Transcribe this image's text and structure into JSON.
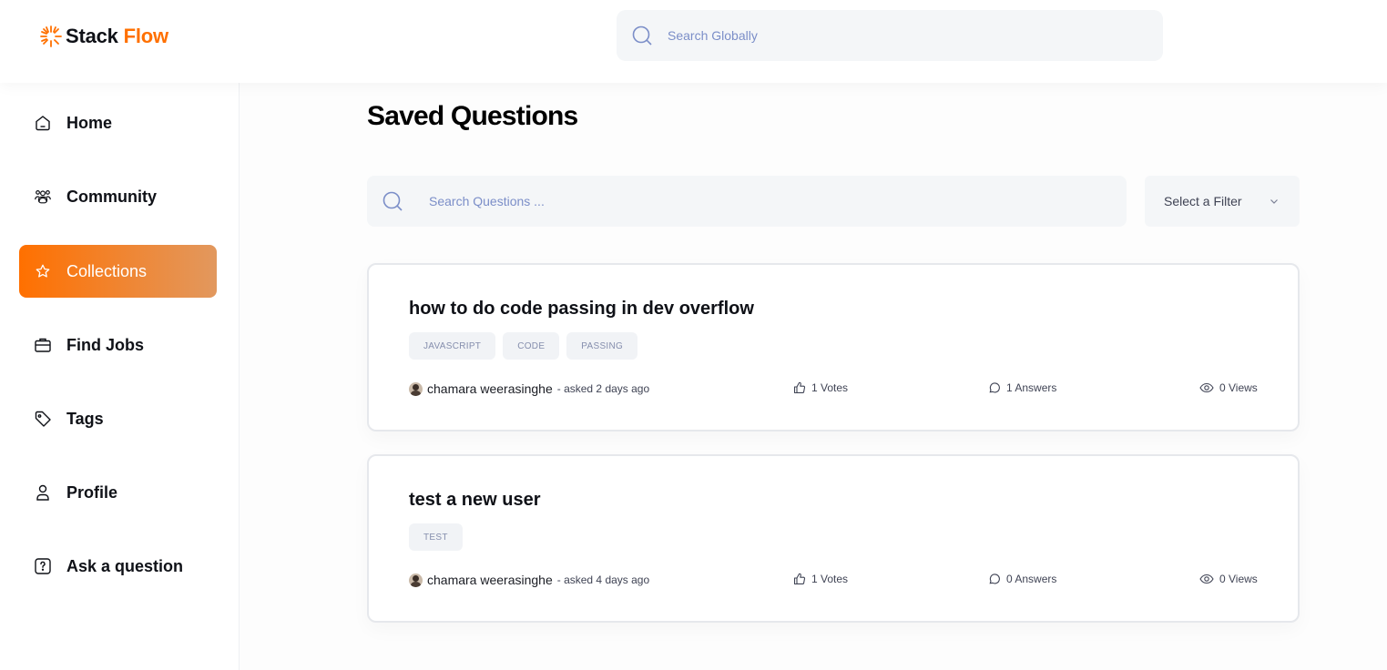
{
  "brand": {
    "name_part1": "Stack",
    "name_part2": "Flow",
    "accent": "#ff7000"
  },
  "global_search": {
    "placeholder": "Search Globally"
  },
  "sidebar": {
    "items": [
      {
        "label": "Home",
        "icon": "home-icon",
        "active": false
      },
      {
        "label": "Community",
        "icon": "users-icon",
        "active": false
      },
      {
        "label": "Collections",
        "icon": "star-icon",
        "active": true
      },
      {
        "label": "Find Jobs",
        "icon": "briefcase-icon",
        "active": false
      },
      {
        "label": "Tags",
        "icon": "tag-icon",
        "active": false
      },
      {
        "label": "Profile",
        "icon": "user-icon",
        "active": false
      },
      {
        "label": "Ask a question",
        "icon": "question-icon",
        "active": false
      }
    ]
  },
  "main": {
    "title": "Saved Questions",
    "search": {
      "placeholder": "Search Questions ..."
    },
    "filter": {
      "label": "Select a Filter"
    },
    "questions": [
      {
        "title": "how to do code passing in dev overflow",
        "tags": [
          "JAVASCRIPT",
          "CODE",
          "PASSING"
        ],
        "author": "chamara weerasinghe",
        "asked": "- asked 2 days ago",
        "votes": "1 Votes",
        "answers": "1 Answers",
        "views": "0 Views"
      },
      {
        "title": "test a new user",
        "tags": [
          "TEST"
        ],
        "author": "chamara weerasinghe",
        "asked": "- asked 4 days ago",
        "votes": "1 Votes",
        "answers": "0 Answers",
        "views": "0 Views"
      }
    ]
  }
}
